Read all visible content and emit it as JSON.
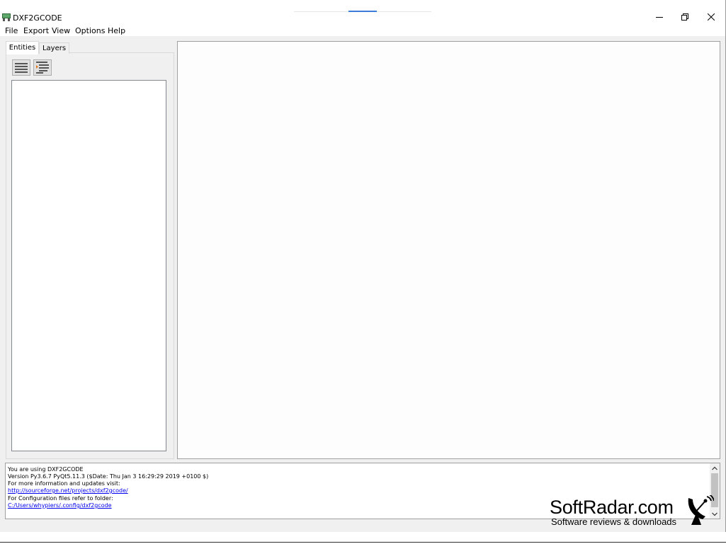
{
  "window": {
    "title": "DXF2GCODE",
    "controls": {
      "minimize": "minimize",
      "maximize": "restore",
      "close": "close"
    }
  },
  "menubar": {
    "items": [
      {
        "label": "File"
      },
      {
        "label": "Export"
      },
      {
        "label": "View"
      },
      {
        "label": "Options"
      },
      {
        "label": "Help"
      }
    ]
  },
  "left_pane": {
    "tabs": [
      {
        "label": "Entities",
        "active": true
      },
      {
        "label": "Layers",
        "active": false
      }
    ],
    "toolbar": [
      {
        "icon": "list-icon"
      },
      {
        "icon": "tree-expand-icon"
      }
    ]
  },
  "log": {
    "lines": [
      {
        "text": "You are using DXF2GCODE",
        "link": false
      },
      {
        "text": "Version Py3.6.7 PyQt5.11.3 ($Date: Thu Jan 3 16:29:29 2019 +0100 $)",
        "link": false
      },
      {
        "text": "For more information and updates visit:",
        "link": false
      },
      {
        "text": "http://sourceforge.net/projects/dxf2gcode/",
        "link": true
      },
      {
        "text": "For Configuration files refer to folder:",
        "link": false
      },
      {
        "text": "C:/Users/whypiers/.config/dxf2gcode",
        "link": true
      }
    ]
  },
  "watermark": {
    "title": "SoftRadar.com",
    "subtitle": "Software reviews & downloads"
  }
}
